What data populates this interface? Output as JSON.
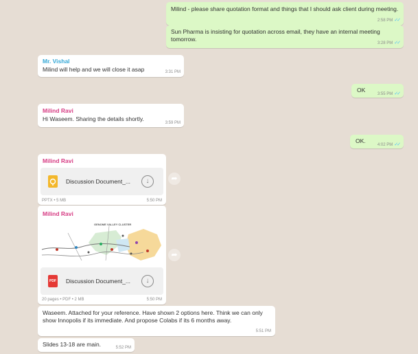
{
  "colors": {
    "outgoing": "#dcf8c6",
    "incoming": "#ffffff",
    "wallpaper": "#e6ddd4",
    "tick": "#4fc3f7"
  },
  "messages": {
    "m1": {
      "text": "Milind - please share quotation format and things that I should ask client during meeting.",
      "time": "2:58 PM",
      "ticks": "✓✓"
    },
    "m2": {
      "text": "Sun Pharma is insisting for quotation across email, they have an internal meeting tomorrow.",
      "time": "3:28 PM",
      "ticks": "✓✓"
    },
    "m3": {
      "sender": "Mr. Vishal",
      "text": "Milind will help and we will close it asap",
      "time": "3:31 PM"
    },
    "m4": {
      "text": "OK",
      "time": "3:55 PM",
      "ticks": "✓✓"
    },
    "m5": {
      "sender": "Milind Ravi",
      "text": "Hi Waseem. Sharing the details shortly.",
      "time": "3:59 PM"
    },
    "m6": {
      "text": "OK.",
      "time": "4:02 PM",
      "ticks": "✓✓"
    },
    "m7": {
      "sender": "Milind Ravi",
      "doc_name": "Discussion Document_...",
      "doc_meta": "PPTX • 5 MB",
      "time": "5:50 PM",
      "icon": "pptx-file-icon"
    },
    "m8": {
      "sender": "Milind Ravi",
      "map_title": "GENOME VALLEY CLUSTER",
      "doc_name": "Discussion Document_...",
      "doc_icon_label": "PDF",
      "doc_meta": "20 pages • PDF • 2 MB",
      "time": "5:50 PM"
    },
    "m9": {
      "text": "Waseem. Attached for your reference. Have shown 2 options here. Think we can only show Innopolis if its immediate. And propose Colabs if its 6 months away.",
      "time": "5:51 PM"
    },
    "m10": {
      "text": "Slides 13-18 are main.",
      "time": "5:52 PM"
    }
  }
}
